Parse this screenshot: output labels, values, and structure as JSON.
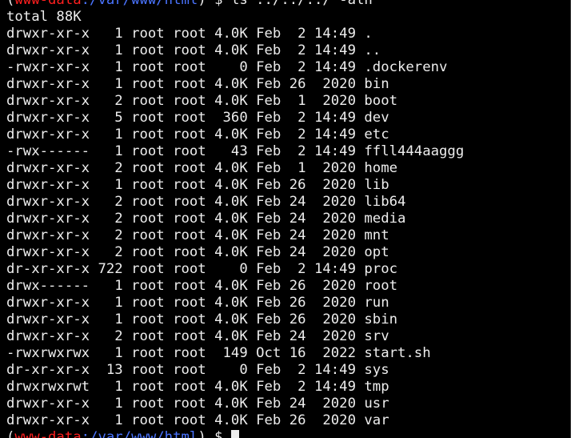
{
  "terminal": {
    "prompt": {
      "open_paren": "(",
      "user": "www-data",
      "separator": ":",
      "path": "/var/www/html",
      "close_paren": ")",
      "dollar": " $ ",
      "command": "ls ../../../ -alh"
    },
    "total_line": "total 88K",
    "listing": [
      "drwxr-xr-x   1 root root 4.0K Feb  2 14:49 .",
      "drwxr-xr-x   1 root root 4.0K Feb  2 14:49 ..",
      "-rwxr-xr-x   1 root root    0 Feb  2 14:49 .dockerenv",
      "drwxr-xr-x   1 root root 4.0K Feb 26  2020 bin",
      "drwxr-xr-x   2 root root 4.0K Feb  1  2020 boot",
      "drwxr-xr-x   5 root root  360 Feb  2 14:49 dev",
      "drwxr-xr-x   1 root root 4.0K Feb  2 14:49 etc",
      "-rwx------   1 root root   43 Feb  2 14:49 ffll444aaggg",
      "drwxr-xr-x   2 root root 4.0K Feb  1  2020 home",
      "drwxr-xr-x   1 root root 4.0K Feb 26  2020 lib",
      "drwxr-xr-x   2 root root 4.0K Feb 24  2020 lib64",
      "drwxr-xr-x   2 root root 4.0K Feb 24  2020 media",
      "drwxr-xr-x   2 root root 4.0K Feb 24  2020 mnt",
      "drwxr-xr-x   2 root root 4.0K Feb 24  2020 opt",
      "dr-xr-xr-x 722 root root    0 Feb  2 14:49 proc",
      "drwx------   1 root root 4.0K Feb 26  2020 root",
      "drwxr-xr-x   1 root root 4.0K Feb 26  2020 run",
      "drwxr-xr-x   1 root root 4.0K Feb 26  2020 sbin",
      "drwxr-xr-x   2 root root 4.0K Feb 24  2020 srv",
      "-rwxrwxrwx   1 root root  149 Oct 16  2022 start.sh",
      "dr-xr-xr-x  13 root root    0 Feb  2 14:49 sys",
      "drwxrwxrwt   1 root root 4.0K Feb  2 14:49 tmp",
      "drwxr-xr-x   1 root root 4.0K Feb 24  2020 usr",
      "drwxr-xr-x   1 root root 4.0K Feb 26  2020 var"
    ],
    "colors": {
      "background": "#000000",
      "text": "#ededed",
      "user": "#ff1f1f",
      "path": "#4a74ff"
    }
  }
}
